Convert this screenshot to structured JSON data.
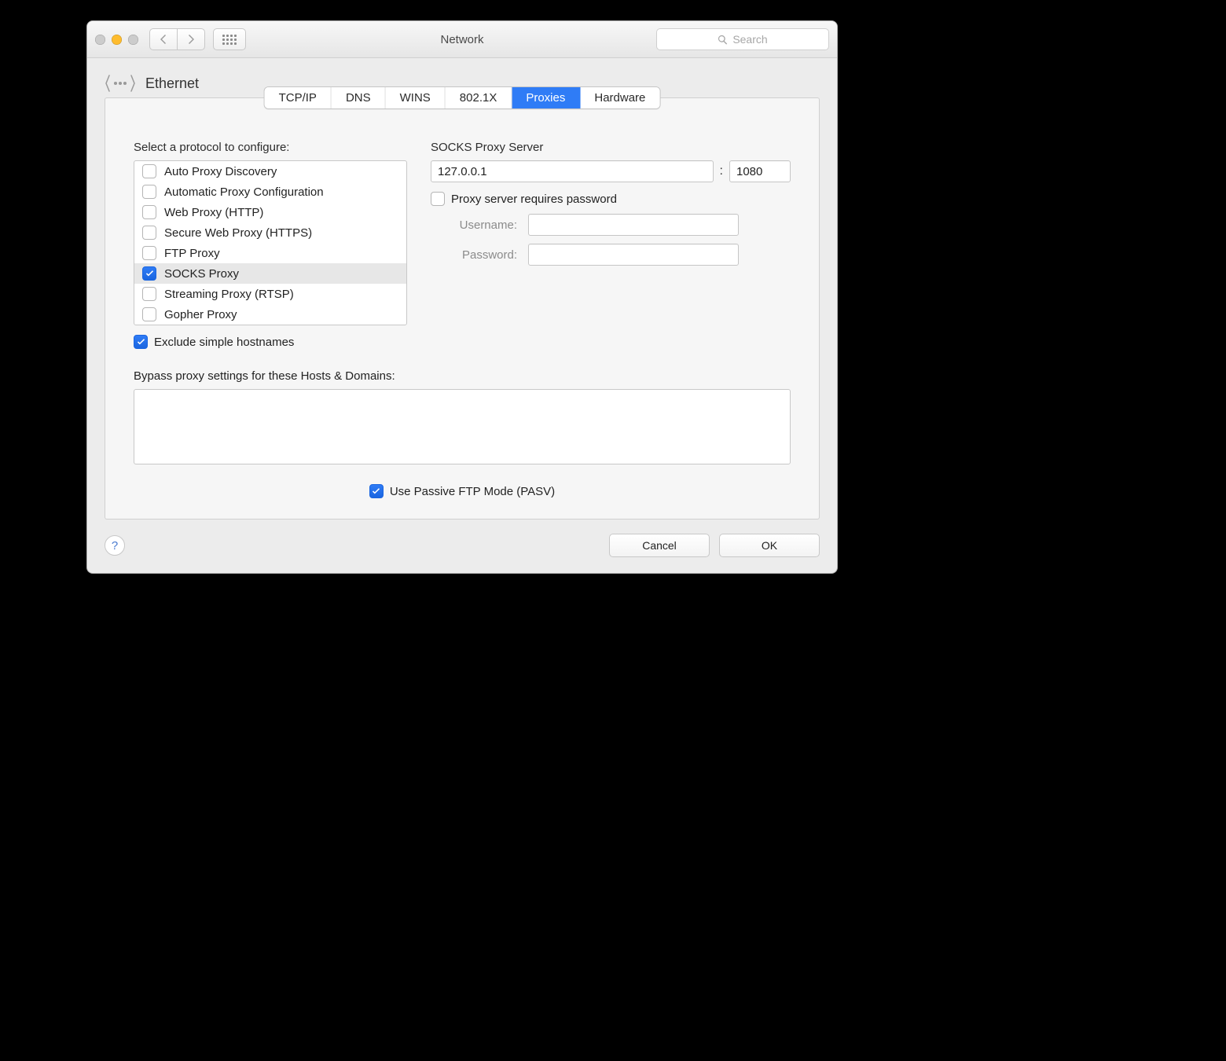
{
  "window": {
    "title": "Network",
    "search_placeholder": "Search"
  },
  "interface": {
    "name": "Ethernet"
  },
  "tabs": [
    {
      "label": "TCP/IP"
    },
    {
      "label": "DNS"
    },
    {
      "label": "WINS"
    },
    {
      "label": "802.1X"
    },
    {
      "label": "Proxies"
    },
    {
      "label": "Hardware"
    }
  ],
  "active_tab_index": 4,
  "protocols": {
    "heading": "Select a protocol to configure:",
    "items": [
      {
        "label": "Auto Proxy Discovery",
        "checked": false
      },
      {
        "label": "Automatic Proxy Configuration",
        "checked": false
      },
      {
        "label": "Web Proxy (HTTP)",
        "checked": false
      },
      {
        "label": "Secure Web Proxy (HTTPS)",
        "checked": false
      },
      {
        "label": "FTP Proxy",
        "checked": false
      },
      {
        "label": "SOCKS Proxy",
        "checked": true
      },
      {
        "label": "Streaming Proxy (RTSP)",
        "checked": false
      },
      {
        "label": "Gopher Proxy",
        "checked": false
      }
    ],
    "selected_index": 5
  },
  "server": {
    "heading": "SOCKS Proxy Server",
    "host": "127.0.0.1",
    "port": "1080",
    "requires_password_label": "Proxy server requires password",
    "requires_password": false,
    "username_label": "Username:",
    "username": "",
    "password_label": "Password:",
    "password": ""
  },
  "exclude_simple": {
    "label": "Exclude simple hostnames",
    "checked": true
  },
  "bypass": {
    "label": "Bypass proxy settings for these Hosts & Domains:",
    "value": ""
  },
  "pasv": {
    "label": "Use Passive FTP Mode (PASV)",
    "checked": true
  },
  "footer": {
    "cancel": "Cancel",
    "ok": "OK"
  }
}
